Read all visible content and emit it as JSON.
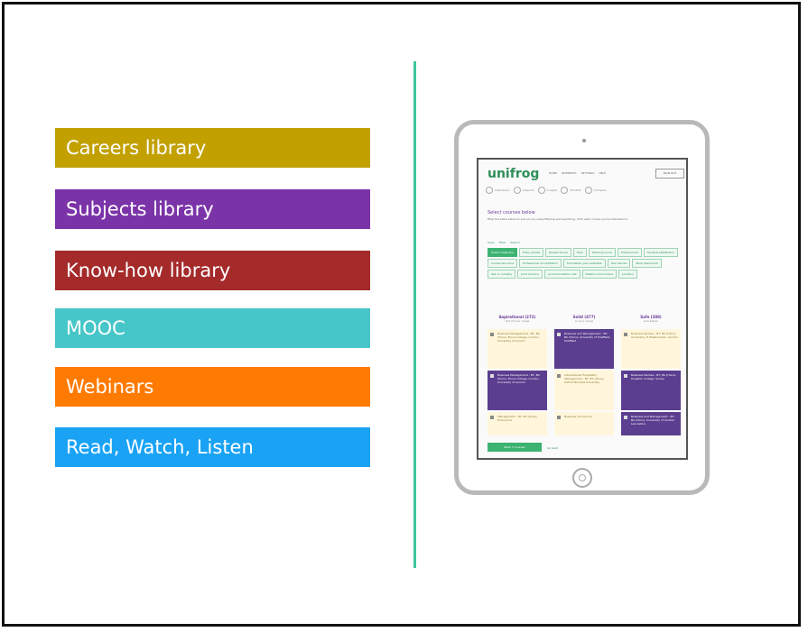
{
  "menu": {
    "items": [
      {
        "label": "Careers library",
        "color": "#c2a000"
      },
      {
        "label": "Subjects library",
        "color": "#7b33a8"
      },
      {
        "label": "Know-how library",
        "color": "#a52a2a"
      },
      {
        "label": "MOOC",
        "color": "#46c6c8"
      },
      {
        "label": "Webinars",
        "color": "#ff7a00"
      },
      {
        "label": "Read, Watch, Listen",
        "color": "#1aa3f5"
      }
    ]
  },
  "divider_color": "#3cc69b",
  "tablet": {
    "logo": "unifrog",
    "nav": [
      "HOME",
      "INTERESTS",
      "SETTINGS",
      "HELP"
    ],
    "signout": "SIGN OUT",
    "steps": [
      "Institutions",
      "Subjects",
      "Insights",
      "Shortlist",
      "Compare"
    ],
    "section_title": "Select courses below",
    "section_text": "Filter the table below to suit you by using filtering and searching. Click each course you're interested in.",
    "filters": [
      "Clear",
      "Filter",
      "Search"
    ],
    "chips": [
      {
        "label": "Select subject(s)",
        "selected": true
      },
      {
        "label": "Entry grades",
        "selected": false
      },
      {
        "label": "Russell Group",
        "selected": false
      },
      {
        "label": "Fees",
        "selected": false
      },
      {
        "label": "Teaching score",
        "selected": false
      },
      {
        "label": "Employment",
        "selected": false
      },
      {
        "label": "Student satisfaction",
        "selected": false
      },
      {
        "label": "Course structure",
        "selected": false
      },
      {
        "label": "Professional accreditation",
        "selected": false
      },
      {
        "label": "Foundation year available",
        "selected": false
      },
      {
        "label": "Year abroad",
        "selected": false
      },
      {
        "label": "Work placement",
        "selected": false
      },
      {
        "label": "Year in industry",
        "selected": false
      },
      {
        "label": "Joint honours",
        "selected": false
      },
      {
        "label": "Accommodation cost",
        "selected": false
      },
      {
        "label": "Distance from home",
        "selected": false
      },
      {
        "label": "Location",
        "selected": false
      }
    ],
    "columns": [
      {
        "title": "Aspirational (272)",
        "subtitle": "Out of your range"
      },
      {
        "title": "Solid (477)",
        "subtitle": "In your range"
      },
      {
        "title": "Safe (388)",
        "subtitle": "Just below"
      }
    ],
    "cards": [
      {
        "col": 0,
        "row": 0,
        "style": "light",
        "text": "Business Management - BT, BA (Hons), Bruce College, London, University of London"
      },
      {
        "col": 0,
        "row": 1,
        "style": "dark",
        "text": "Business Management - BT, BA (Hons), Bruce College, London, University of London"
      },
      {
        "col": 0,
        "row": 2,
        "style": "light",
        "text": "Management - BT, BA (Hons), Economics"
      },
      {
        "col": 1,
        "row": 0,
        "style": "dark",
        "text": "Business and Management - BT, BA (Hons), University of Sheffield, Sheffield"
      },
      {
        "col": 1,
        "row": 1,
        "style": "light",
        "text": "International Hospitality Management - BT, BA (Hons), Oxford Brookes University"
      },
      {
        "col": 1,
        "row": 2,
        "style": "light",
        "text": "Business, Economics"
      },
      {
        "col": 2,
        "row": 0,
        "style": "light",
        "text": "Business Studies - BT, BA (Hons), University of Westminster, London"
      },
      {
        "col": 2,
        "row": 1,
        "style": "dark",
        "text": "Business Studies - BT, BA (Hons), Kingston College, Surrey"
      },
      {
        "col": 2,
        "row": 2,
        "style": "dark",
        "text": "Business and Management - BT, BA (Hons), University of Central Lancashire"
      }
    ],
    "next_button": "Next: 5 courses",
    "back_link": "Go back"
  }
}
